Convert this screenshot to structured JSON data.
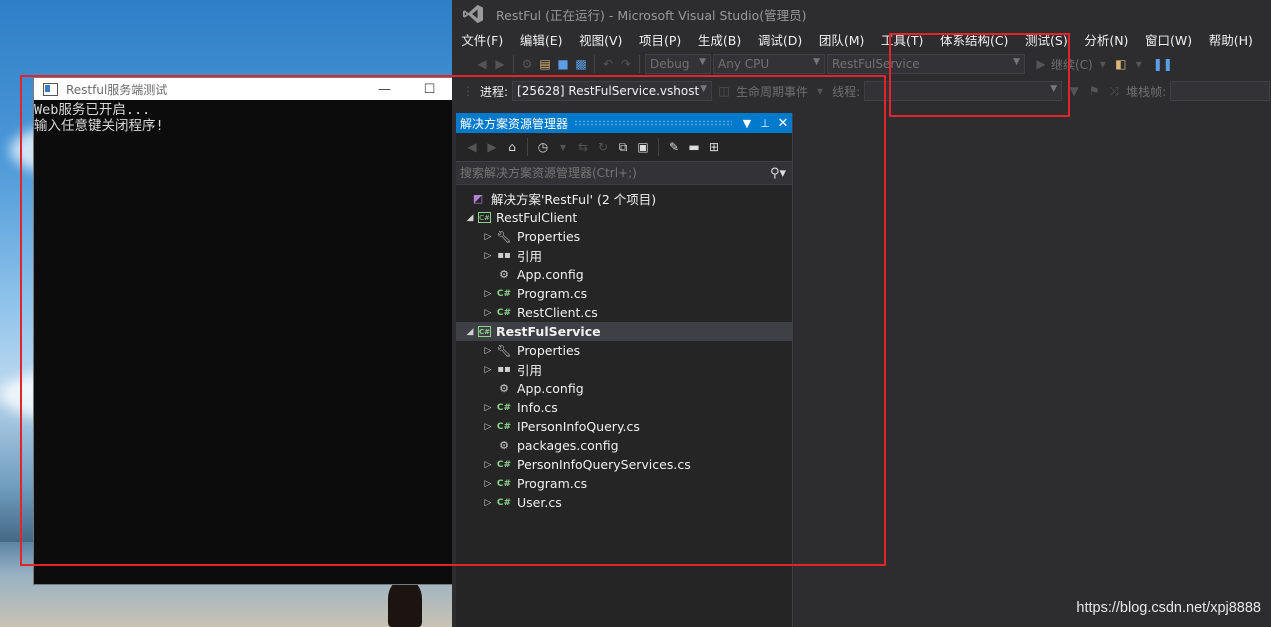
{
  "console": {
    "title": "Restful服务端测试",
    "minimize": "—",
    "maximize": "☐",
    "lines": [
      "Web服务已开启...",
      "输入任意键关闭程序!"
    ]
  },
  "vs": {
    "title": "RestFul (正在运行) - Microsoft Visual Studio(管理员)",
    "menu": [
      "文件(F)",
      "编辑(E)",
      "视图(V)",
      "项目(P)",
      "生成(B)",
      "调试(D)",
      "团队(M)",
      "工具(T)",
      "体系结构(C)",
      "测试(S)",
      "分析(N)",
      "窗口(W)",
      "帮助(H)"
    ],
    "toolbar": {
      "config": "Debug",
      "platform": "Any CPU",
      "startup": "RestFulService",
      "continue": "继续(C)"
    },
    "debugbar": {
      "process_label": "进程:",
      "process_value": "[25628] RestFulService.vshost.e",
      "lifecycle": "生命周期事件",
      "thread_label": "线程:",
      "stack_label": "堆栈帧:"
    }
  },
  "solution_explorer": {
    "title": "解决方案资源管理器",
    "search_placeholder": "搜索解决方案资源管理器(Ctrl+;)",
    "items": [
      {
        "label": "解决方案'RestFul' (2 个项目)",
        "icon": "solution-icon"
      },
      {
        "label": "RestFulClient",
        "icon": "csharp-project-icon"
      },
      {
        "label": "Properties",
        "icon": "wrench-icon"
      },
      {
        "label": "引用",
        "icon": "reference-icon"
      },
      {
        "label": "App.config",
        "icon": "config-icon"
      },
      {
        "label": "Program.cs",
        "icon": "csharp-file-icon"
      },
      {
        "label": "RestClient.cs",
        "icon": "csharp-file-icon"
      },
      {
        "label": "RestFulService",
        "icon": "csharp-project-icon"
      },
      {
        "label": "Properties",
        "icon": "wrench-icon"
      },
      {
        "label": "引用",
        "icon": "reference-icon"
      },
      {
        "label": "App.config",
        "icon": "config-icon"
      },
      {
        "label": "Info.cs",
        "icon": "csharp-file-icon"
      },
      {
        "label": "IPersonInfoQuery.cs",
        "icon": "csharp-file-icon"
      },
      {
        "label": "packages.config",
        "icon": "config-icon"
      },
      {
        "label": "PersonInfoQueryServices.cs",
        "icon": "csharp-file-icon"
      },
      {
        "label": "Program.cs",
        "icon": "csharp-file-icon"
      },
      {
        "label": "User.cs",
        "icon": "csharp-file-icon"
      }
    ]
  },
  "watermark": "https://blog.csdn.net/xpj8888",
  "colors": {
    "accent": "#007acc",
    "annotation": "#e1262b",
    "csharp": "#8dd28a"
  }
}
